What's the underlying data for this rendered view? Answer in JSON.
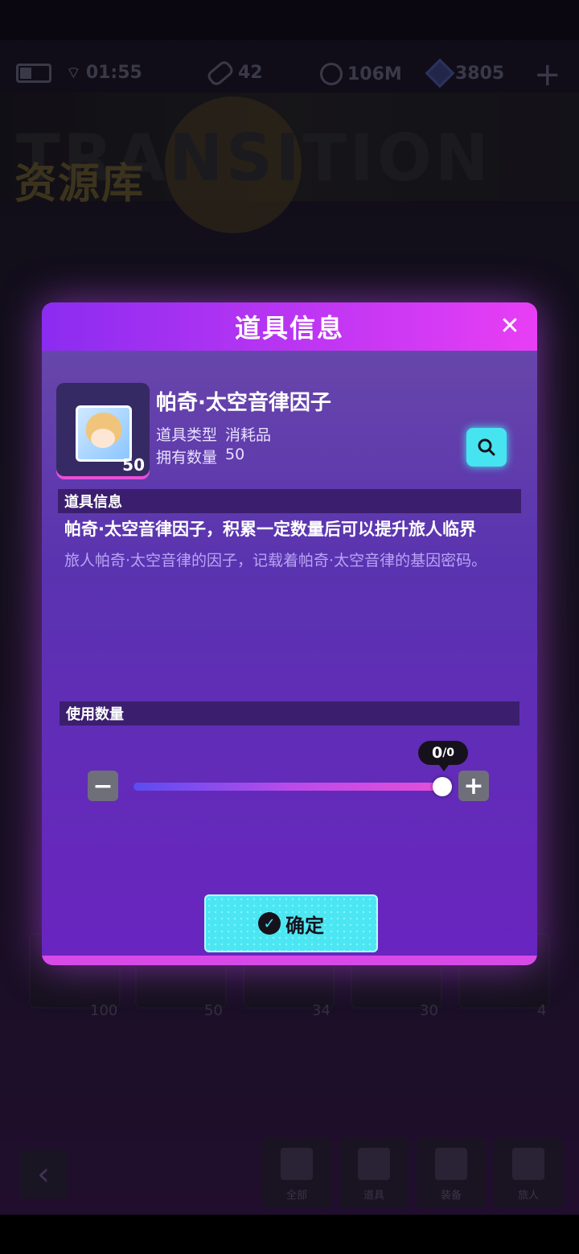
{
  "status": {
    "time": "01:55"
  },
  "currencies": [
    {
      "icon": "bandage-icon",
      "value": "42"
    },
    {
      "icon": "coin-icon",
      "value": "106M"
    },
    {
      "icon": "cube-icon",
      "value": "3805"
    }
  ],
  "banner": {
    "title": "资源库"
  },
  "background_counts": [
    "100",
    "50",
    "34",
    "30",
    "4"
  ],
  "dialog": {
    "title": "道具信息",
    "item": {
      "name": "帕奇·太空音律因子",
      "count": "50",
      "type_label": "道具类型",
      "type_value": "消耗品",
      "owned_label": "拥有数量",
      "owned_value": "50"
    },
    "info_section_title": "道具信息",
    "description_main": "帕奇·太空音律因子，积累一定数量后可以提升旅人临界",
    "description_sub": "旅人帕奇·太空音律的因子，记载着帕奇·太空音律的基因密码。",
    "use_section_title": "使用数量",
    "slider": {
      "current": 0,
      "max": 0,
      "display_current": "0",
      "display_max": "/0"
    },
    "confirm_label": "确定",
    "colors": {
      "header_start": "#8b2cf0",
      "header_end": "#e83ef5",
      "accent_cyan": "#4ce6f2"
    }
  },
  "bottom_nav": {
    "tabs": [
      {
        "label": "全部"
      },
      {
        "label": "道具"
      },
      {
        "label": "装备"
      },
      {
        "label": "旅人"
      }
    ]
  }
}
